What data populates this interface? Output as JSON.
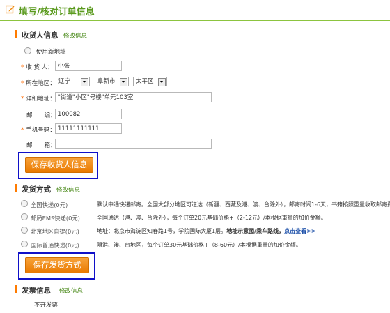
{
  "header": {
    "title": "填写/核对订单信息"
  },
  "recipient": {
    "title": "收货人信息",
    "edit_link": "修改信息",
    "use_new_address": "使用新地址",
    "name_label": "收 货 人：",
    "name_value": "小张",
    "region_label": "所在地区：",
    "province": "辽宁",
    "city": "阜新市",
    "district": "太平区",
    "address_label": "详细地址：",
    "address_value": "\"街道\"小区\"号楼\"单元103室",
    "zip_label": "邮　　编：",
    "zip_value": "100082",
    "phone_label": "手机号码：",
    "phone_value": "11111111111",
    "email_label": "邮　　箱：",
    "email_value": "",
    "save_button": "保存收货人信息"
  },
  "shipping": {
    "title": "发货方式",
    "edit_link": "修改信息",
    "options": [
      {
        "name": "全国快递(0元)",
        "desc": "默认中通快递邮寄。全国大部分地区可送达（新疆、西藏及港、澳、台除外），邮寄时间1-6天，书籍按照重量收取邮寄费。"
      },
      {
        "name": "邮局EMS快递(0元)",
        "desc": "全国通达（港、澳、台除外），每个订单20元基础价格+（2-12元）/本根据重量的加价金额。"
      },
      {
        "name": "北京地区自提(0元)",
        "desc_prefix": "地址：北京市海淀区知春路1号，学院国际大厦1层。",
        "desc_map": "地址示意图/乘车路线，",
        "desc_link": "点击查看>>"
      },
      {
        "name": "国际普通快递(0元)",
        "desc": "限港、澳、台地区，每个订单30元基础价格+（8-60元）/本根据重量的加价金额。"
      }
    ],
    "save_button": "保存发货方式"
  },
  "invoice": {
    "title": "发票信息",
    "edit_link": "修改信息",
    "value": "不开发票"
  },
  "colors": {
    "accent": "#8cc43f",
    "orange": "#f08a12",
    "focus": "#1010c8"
  }
}
